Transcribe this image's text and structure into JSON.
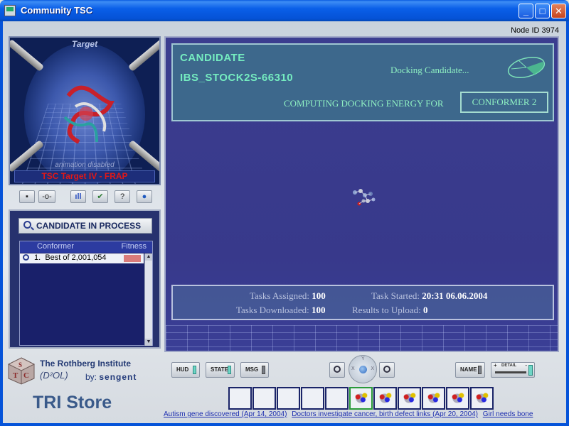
{
  "window": {
    "title": "Community TSC",
    "minimize": "_",
    "maximize": "□",
    "close": "✕"
  },
  "node_id": "Node ID 3974",
  "target": {
    "title": "Target",
    "animation_note": "animation disabled",
    "name": "TSC Target IV - FRAP"
  },
  "toolbar": {
    "buttons": [
      {
        "name": "stop-icon",
        "glyph": "▪"
      },
      {
        "name": "connect-icon",
        "glyph": "-o-"
      },
      {
        "name": "stats-icon",
        "glyph": "ıll"
      },
      {
        "name": "check-icon",
        "glyph": "✔"
      },
      {
        "name": "help-icon",
        "glyph": "?"
      },
      {
        "name": "globe-icon",
        "glyph": "●"
      }
    ]
  },
  "candidate_panel": {
    "header": "CANDIDATE IN PROCESS",
    "columns": [
      "Conformer",
      "Fitness"
    ],
    "rows": [
      {
        "rank": "1.",
        "label": "Best of 2,001,054"
      }
    ]
  },
  "hud": {
    "candidate_label": "CANDIDATE",
    "candidate_id": "IBS_STOCK2S-66310",
    "status": "Docking Candidate...",
    "computing_label": "COMPUTING DOCKING ENERGY FOR",
    "conformer": "CONFORMER 2"
  },
  "stats": {
    "tasks_assigned_label": "Tasks Assigned:",
    "tasks_assigned": "100",
    "tasks_downloaded_label": "Tasks Downloaded:",
    "tasks_downloaded": "100",
    "task_started_label": "Task Started:",
    "task_started": "20:31 06.06.2004",
    "results_label": "Results to Upload:",
    "results": "0"
  },
  "branding": {
    "institute": "The Rothberg Institute",
    "d2ol": "(D²OL)",
    "by": "by:",
    "sengent": "sengent",
    "store": "TRI Store"
  },
  "controls": {
    "hud": "HUD",
    "state": "STATE",
    "msg": "MSG",
    "name": "NAME",
    "detail": "DETAIL",
    "detail_plus": "+",
    "detail_minus": "-",
    "nav": {
      "y": "Y",
      "x_left": "X",
      "x_right": "X"
    }
  },
  "news": [
    "Autism gene discovered  (Apr 14, 2004)",
    "Doctors investigate cancer, birth defect links  (Apr 20, 2004)",
    "Girl needs bone"
  ],
  "colors": {
    "hud_text": "#75ecc0",
    "target_name": "#e01818",
    "fitness_bar": "#d97b7b"
  }
}
